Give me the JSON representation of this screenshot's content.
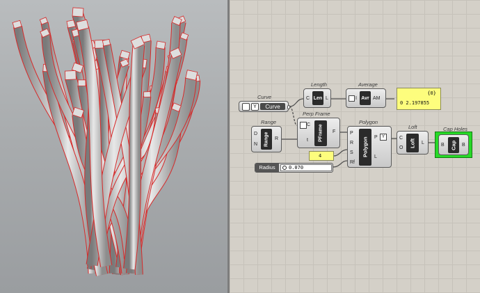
{
  "graph": {
    "curve": {
      "title": "Curve",
      "label": "Curve"
    },
    "length": {
      "title": "Length",
      "input": "C",
      "core": "Len",
      "output": "L"
    },
    "average": {
      "title": "Average",
      "input": "I",
      "core": "Avr",
      "output": "AM"
    },
    "panel": {
      "header": "{0}",
      "value": "0 2.197855"
    },
    "range": {
      "title": "Range",
      "input_d": "D",
      "input_n": "N",
      "core": "Range",
      "output": "R"
    },
    "perp_frame": {
      "title": "Perp Frame",
      "input_c": "C",
      "input_t": "t",
      "core": "PFrame",
      "output": "F"
    },
    "polygon": {
      "title": "Polygon",
      "input_p": "P",
      "input_r": "R",
      "input_s": "S",
      "input_rf": "Rf",
      "core": "Polygon",
      "output_p": "P",
      "output_l": "L"
    },
    "loft": {
      "title": "Loft",
      "input_c": "C",
      "input_o": "O",
      "core": "Loft",
      "output": "L"
    },
    "cap_holes": {
      "title": "Cap Holes",
      "input": "B",
      "core": "Cap",
      "output": "B"
    },
    "sides_panel": {
      "value": "4"
    },
    "radius_slider": {
      "label": "Radius",
      "value": "0.070"
    }
  },
  "colors": {
    "wire_color": "#505050",
    "panel_yellow": "#fdfd7d",
    "selection_green": "#27d927",
    "curve_red": "#d62a2a",
    "viewport_gray": "#a9acae"
  }
}
